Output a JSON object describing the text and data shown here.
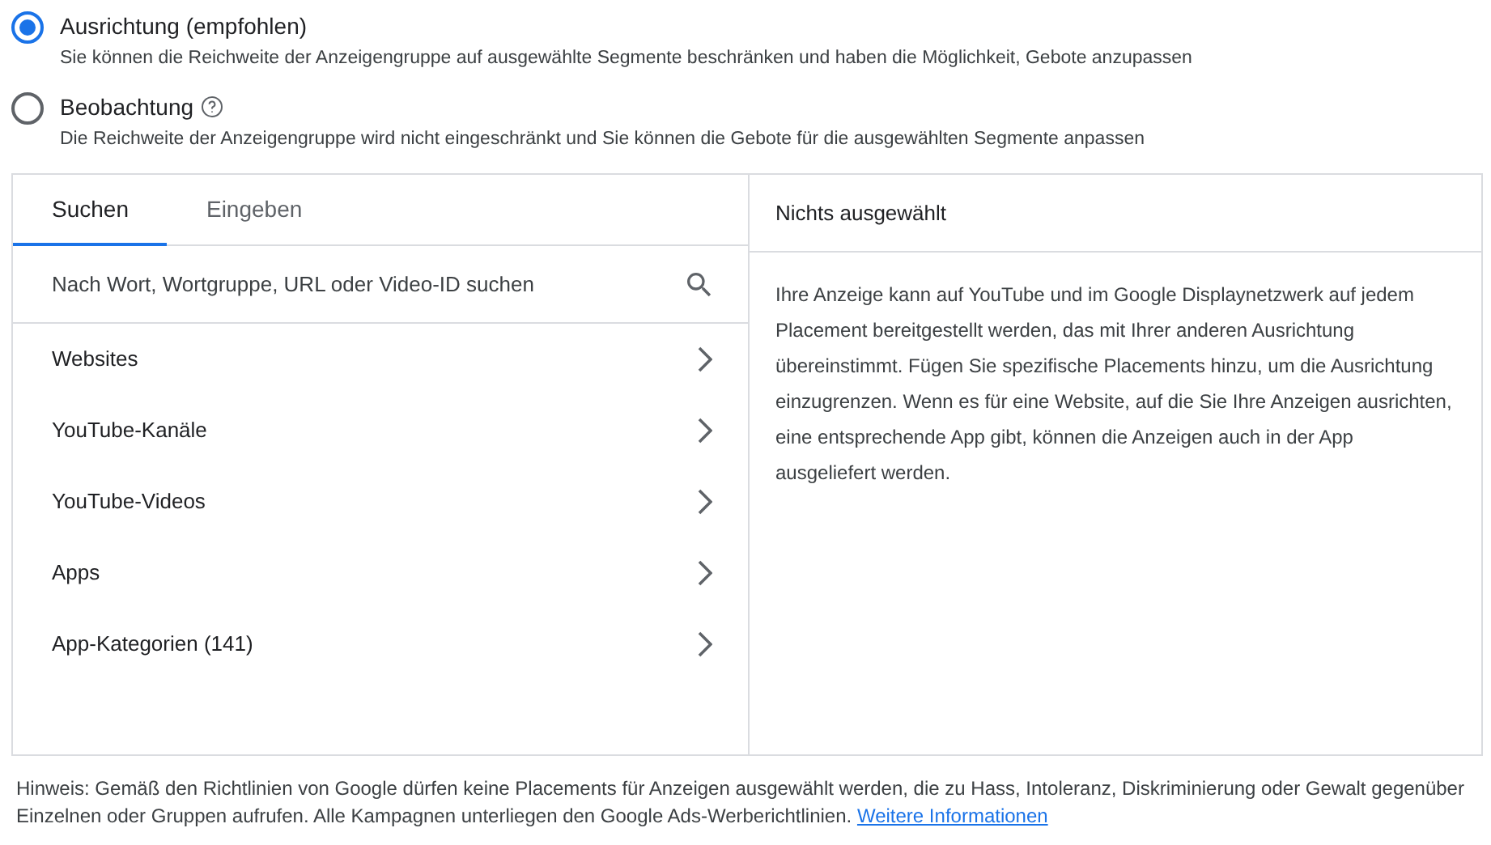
{
  "options": [
    {
      "title": "Ausrichtung (empfohlen)",
      "description": "Sie können die Reichweite der Anzeigengruppe auf ausgewählte Segmente beschränken und haben die Möglichkeit, Gebote anzupassen",
      "selected": true,
      "help": false
    },
    {
      "title": "Beobachtung",
      "description": "Die Reichweite der Anzeigengruppe wird nicht eingeschränkt und Sie können die Gebote für die ausgewählten Segmente anpassen",
      "selected": false,
      "help": true
    }
  ],
  "tabs": [
    {
      "label": "Suchen",
      "selected": true
    },
    {
      "label": "Eingeben",
      "selected": false
    }
  ],
  "search": {
    "placeholder": "Nach Wort, Wortgruppe, URL oder Video-ID suchen"
  },
  "categories": [
    {
      "label": "Websites"
    },
    {
      "label": "YouTube-Kanäle"
    },
    {
      "label": "YouTube-Videos"
    },
    {
      "label": "Apps"
    },
    {
      "label": "App-Kategorien (141)"
    }
  ],
  "selection": {
    "header": "Nichts ausgewählt",
    "description": "Ihre Anzeige kann auf YouTube und im Google Displaynetzwerk auf jedem Placement bereitgestellt werden, das mit Ihrer anderen Ausrichtung übereinstimmt. Fügen Sie spezifische Placements hinzu, um die Ausrichtung einzugrenzen. Wenn es für eine Website, auf die Sie Ihre Anzeigen ausrichten, eine entsprechende App gibt, können die Anzeigen auch in der App ausgeliefert werden."
  },
  "footer": {
    "text": "Hinweis: Gemäß den Richtlinien von Google dürfen keine Placements für Anzeigen ausgewählt werden, die zu Hass, Intoleranz, Diskriminierung oder Gewalt gegenüber Einzelnen oder Gruppen aufrufen. Alle Kampagnen unterliegen den Google Ads-Werberichtlinien.",
    "link": "Weitere Informationen"
  }
}
